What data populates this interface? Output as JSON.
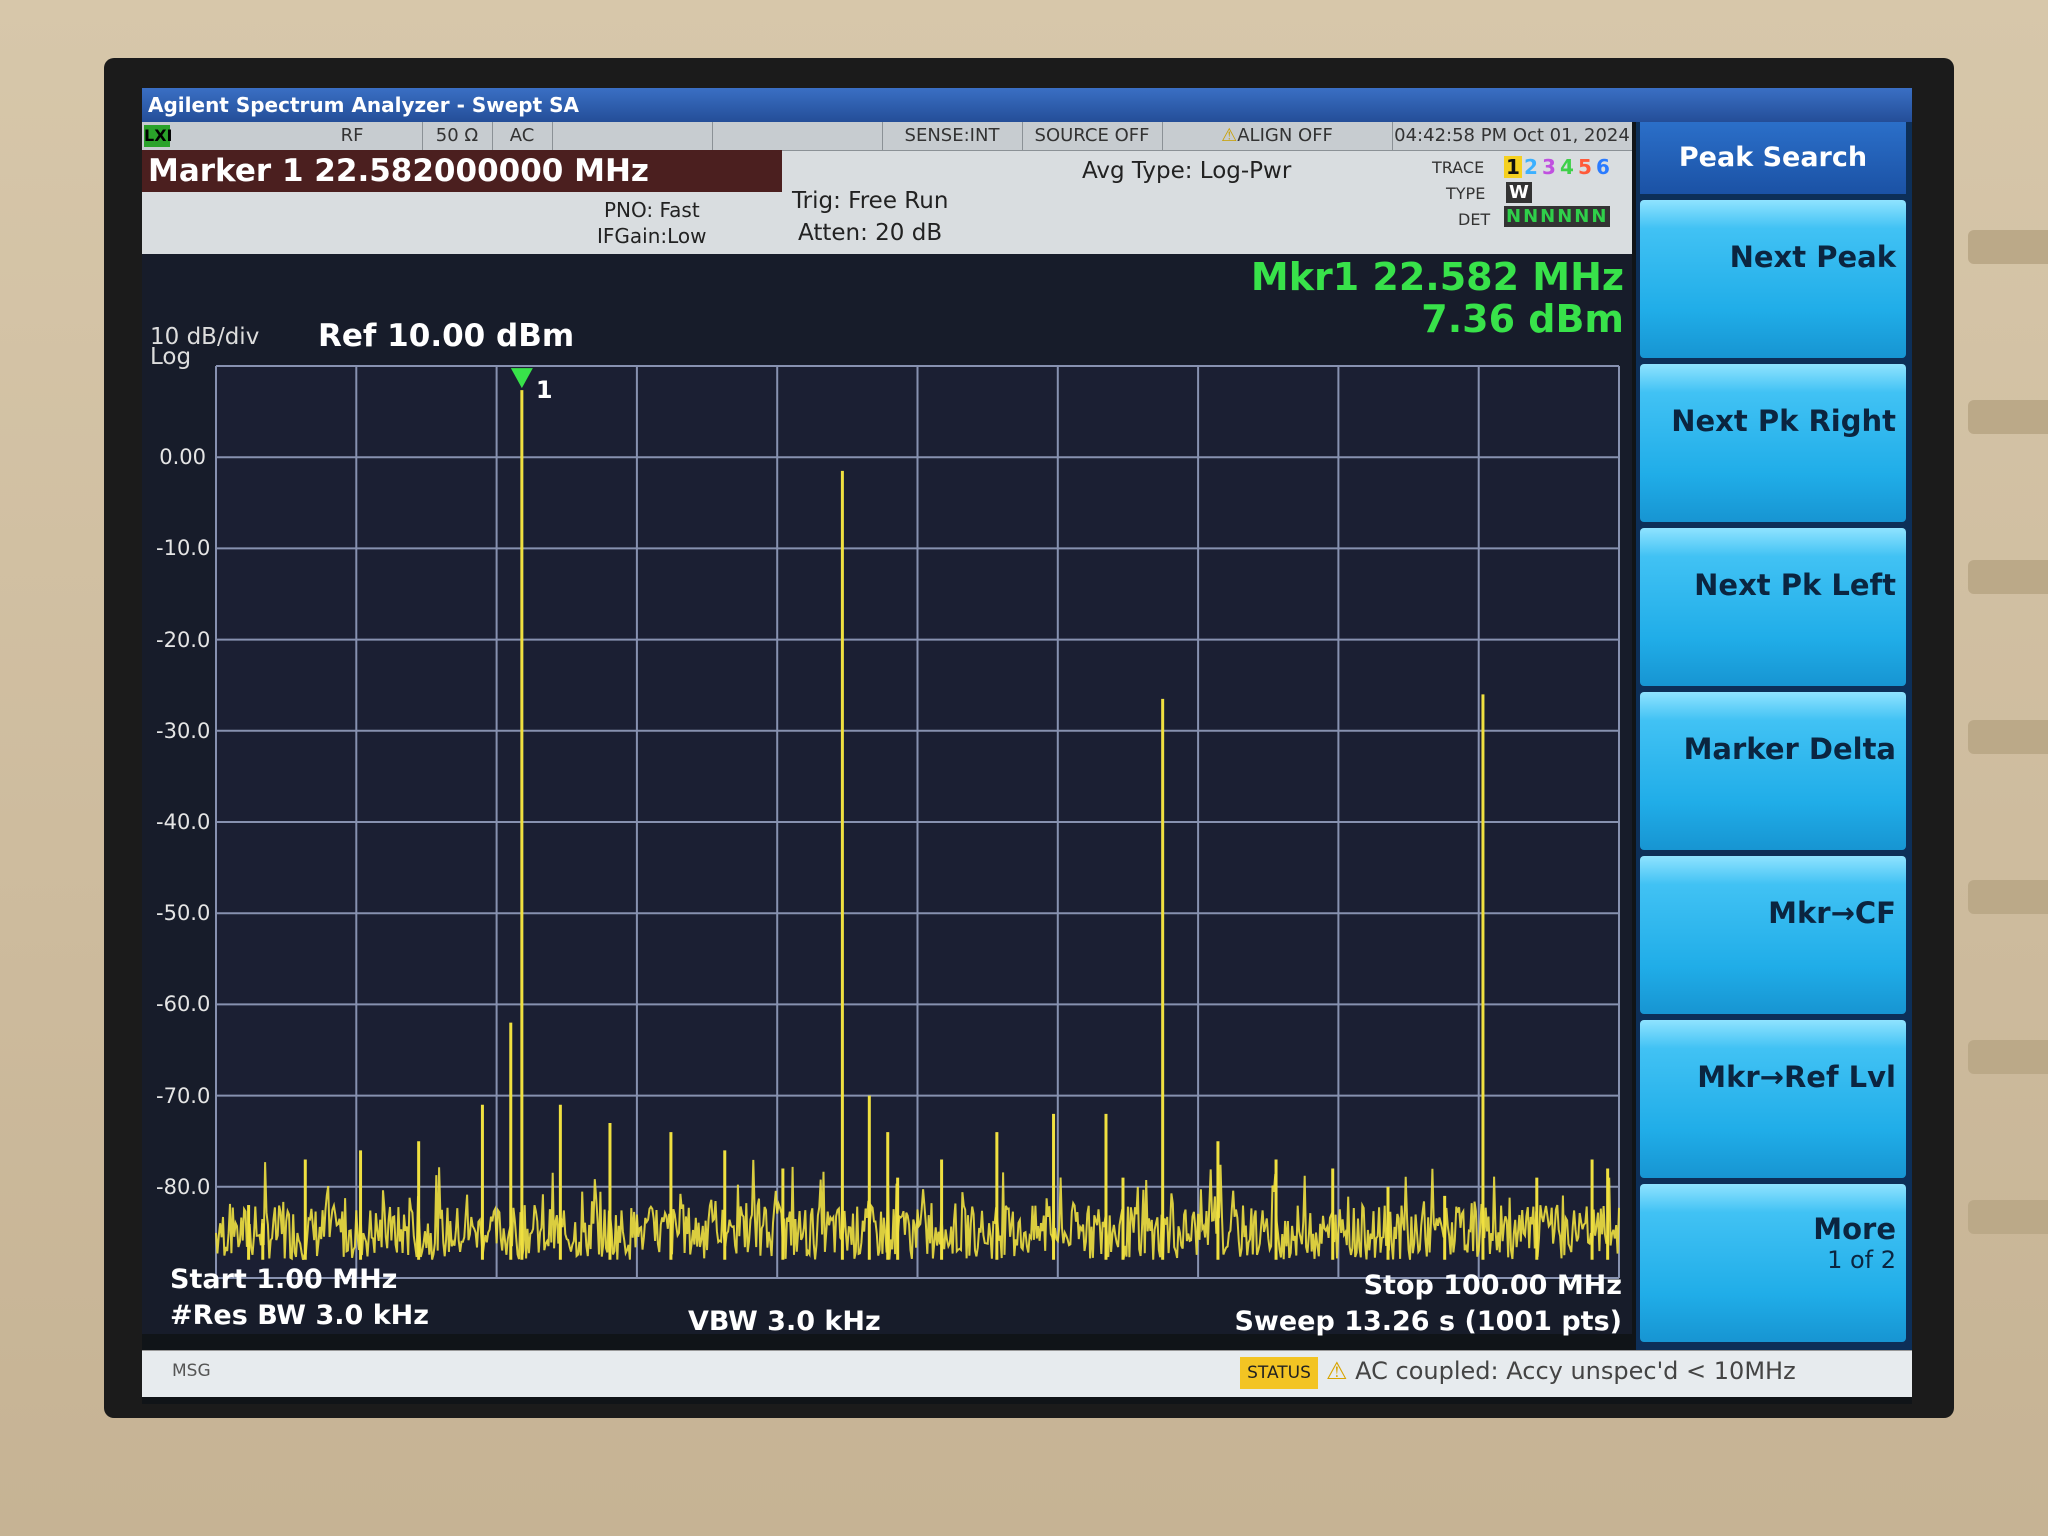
{
  "window": {
    "title": "Agilent Spectrum Analyzer - Swept SA"
  },
  "status_bar": {
    "lxi": "LXI",
    "rf": "RF",
    "impedance": "50 Ω",
    "coupling": "AC",
    "sense": "SENSE:INT",
    "source": "SOURCE OFF",
    "align": "ALIGN OFF",
    "datetime": "04:42:58 PM Oct 01, 2024"
  },
  "marker_header": {
    "label": "Marker 1 22.582000000 MHz",
    "pno": "PNO: Fast",
    "ifgain": "IFGain:Low",
    "trig": "Trig: Free Run",
    "atten": "Atten: 20 dB",
    "avg_type": "Avg Type: Log-Pwr"
  },
  "trace_panel": {
    "trace_label": "TRACE",
    "type_label": "TYPE",
    "det_label": "DET",
    "trace_numbers": [
      "1",
      "2",
      "3",
      "4",
      "5",
      "6"
    ],
    "trace_colors": [
      "#f5d020",
      "#3bb0ff",
      "#c050e0",
      "#3fd04a",
      "#ff5a3a",
      "#2a7bff"
    ],
    "type_value": "W",
    "det_value": "NNNNNN"
  },
  "display": {
    "scale": "10 dB/div",
    "scale_type": "Log",
    "ref_level": "Ref 10.00 dBm",
    "marker_readout_freq": "Mkr1 22.582 MHz",
    "marker_readout_amp": "7.36 dBm",
    "marker_flag": "1",
    "trace_color": "#f0e040",
    "start": "Start 1.00 MHz",
    "res_bw": "#Res BW 3.0 kHz",
    "vbw": "VBW 3.0 kHz",
    "stop": "Stop 100.00 MHz",
    "sweep": "Sweep  13.26 s (1001 pts)"
  },
  "chart_data": {
    "type": "line",
    "x_range_mhz": [
      1.0,
      100.0
    ],
    "y_range_dbm": [
      -90.0,
      10.0
    ],
    "y_tick_labels": [
      "0.00",
      "-10.0",
      "-20.0",
      "-30.0",
      "-40.0",
      "-50.0",
      "-60.0",
      "-70.0",
      "-80.0"
    ],
    "grid": true,
    "noise_floor_dbm": -88,
    "peaks": [
      {
        "f": 22.582,
        "dbm": 7.36
      },
      {
        "f": 45.2,
        "dbm": -1.5
      },
      {
        "f": 67.8,
        "dbm": -26.5
      },
      {
        "f": 90.4,
        "dbm": -26.0
      },
      {
        "f": 3.3,
        "dbm": -82
      },
      {
        "f": 4.3,
        "dbm": -84
      },
      {
        "f": 7.3,
        "dbm": -77
      },
      {
        "f": 11.2,
        "dbm": -76
      },
      {
        "f": 15.3,
        "dbm": -75
      },
      {
        "f": 19.8,
        "dbm": -71
      },
      {
        "f": 21.8,
        "dbm": -62
      },
      {
        "f": 25.3,
        "dbm": -71
      },
      {
        "f": 28.8,
        "dbm": -73
      },
      {
        "f": 33.1,
        "dbm": -74
      },
      {
        "f": 36.9,
        "dbm": -76
      },
      {
        "f": 41.0,
        "dbm": -78
      },
      {
        "f": 49.1,
        "dbm": -79
      },
      {
        "f": 52.2,
        "dbm": -77
      },
      {
        "f": 56.1,
        "dbm": -74
      },
      {
        "f": 60.1,
        "dbm": -72
      },
      {
        "f": 63.8,
        "dbm": -72
      },
      {
        "f": 65.0,
        "dbm": -79
      },
      {
        "f": 48.4,
        "dbm": -74
      },
      {
        "f": 47.1,
        "dbm": -70
      },
      {
        "f": 71.7,
        "dbm": -75
      },
      {
        "f": 75.8,
        "dbm": -77
      },
      {
        "f": 79.8,
        "dbm": -78
      },
      {
        "f": 83.7,
        "dbm": -80
      },
      {
        "f": 87.7,
        "dbm": -81
      },
      {
        "f": 94.2,
        "dbm": -79
      },
      {
        "f": 98.1,
        "dbm": -77
      },
      {
        "f": 99.2,
        "dbm": -78
      }
    ]
  },
  "softkeys": {
    "header": "Peak Search",
    "keys": [
      {
        "label": "Next Peak"
      },
      {
        "label": "Next Pk Right"
      },
      {
        "label": "Next Pk Left"
      },
      {
        "label": "Marker Delta"
      },
      {
        "label": "Mkr→CF"
      },
      {
        "label": "Mkr→Ref Lvl"
      },
      {
        "label": "More",
        "sub": "1 of 2"
      }
    ]
  },
  "message_bar": {
    "msg_label": "MSG",
    "status_label": "STATUS",
    "status_text": "AC coupled: Accy unspec'd < 10MHz"
  }
}
